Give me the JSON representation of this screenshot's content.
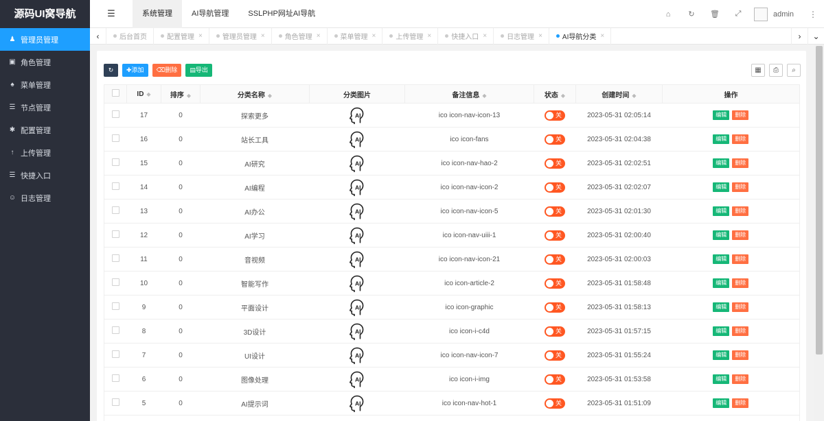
{
  "app": {
    "title": "源码UI窝导航"
  },
  "sidebar": {
    "items": [
      {
        "label": "管理员管理",
        "icon": "user-icon",
        "glyph": "♟",
        "active": true
      },
      {
        "label": "角色管理",
        "icon": "role-icon",
        "glyph": "▣"
      },
      {
        "label": "菜单管理",
        "icon": "bell-icon",
        "glyph": "♠"
      },
      {
        "label": "节点管理",
        "icon": "list-icon",
        "glyph": "☰"
      },
      {
        "label": "配置管理",
        "icon": "gear-icon",
        "glyph": "✱"
      },
      {
        "label": "上传管理",
        "icon": "upload-icon",
        "glyph": "↑"
      },
      {
        "label": "快捷入口",
        "icon": "list-icon",
        "glyph": "☰"
      },
      {
        "label": "日志管理",
        "icon": "log-icon",
        "glyph": "☺"
      }
    ]
  },
  "header": {
    "nav": [
      {
        "label": "系统管理",
        "active": true
      },
      {
        "label": "AI导航管理"
      },
      {
        "label": "SSLPHP网址AI导航"
      }
    ],
    "user": "admin"
  },
  "tabs": [
    {
      "label": "后台首页",
      "closable": false
    },
    {
      "label": "配置管理",
      "closable": true
    },
    {
      "label": "管理员管理",
      "closable": true
    },
    {
      "label": "角色管理",
      "closable": true
    },
    {
      "label": "菜单管理",
      "closable": true
    },
    {
      "label": "上传管理",
      "closable": true
    },
    {
      "label": "快捷入口",
      "closable": true
    },
    {
      "label": "日志管理",
      "closable": true
    },
    {
      "label": "AI导航分类",
      "closable": true,
      "active": true
    }
  ],
  "toolbar": {
    "add_label": "添加",
    "delete_label": "删除",
    "export_label": "导出"
  },
  "table": {
    "headers": {
      "id": "ID",
      "sort": "排序",
      "name": "分类名称",
      "image": "分类图片",
      "remark": "备注信息",
      "status": "状态",
      "created": "创建时间",
      "actions": "操作"
    },
    "status_off_label": "关",
    "edit_label": "编辑",
    "delete_label": "删除",
    "rows": [
      {
        "id": "17",
        "sort": "0",
        "name": "探索更多",
        "remark": "ico icon-nav-icon-13",
        "created": "2023-05-31 02:05:14"
      },
      {
        "id": "16",
        "sort": "0",
        "name": "站长工具",
        "remark": "ico icon-fans",
        "created": "2023-05-31 02:04:38"
      },
      {
        "id": "15",
        "sort": "0",
        "name": "AI研究",
        "remark": "ico icon-nav-hao-2",
        "created": "2023-05-31 02:02:51"
      },
      {
        "id": "14",
        "sort": "0",
        "name": "AI编程",
        "remark": "ico icon-nav-icon-2",
        "created": "2023-05-31 02:02:07"
      },
      {
        "id": "13",
        "sort": "0",
        "name": "AI办公",
        "remark": "ico icon-nav-icon-5",
        "created": "2023-05-31 02:01:30"
      },
      {
        "id": "12",
        "sort": "0",
        "name": "AI学习",
        "remark": "ico icon-nav-uiii-1",
        "created": "2023-05-31 02:00:40"
      },
      {
        "id": "11",
        "sort": "0",
        "name": "音视频",
        "remark": "ico icon-nav-icon-21",
        "created": "2023-05-31 02:00:03"
      },
      {
        "id": "10",
        "sort": "0",
        "name": "智能写作",
        "remark": "ico icon-article-2",
        "created": "2023-05-31 01:58:48"
      },
      {
        "id": "9",
        "sort": "0",
        "name": "平面设计",
        "remark": "ico icon-graphic",
        "created": "2023-05-31 01:58:13"
      },
      {
        "id": "8",
        "sort": "0",
        "name": "3D设计",
        "remark": "ico icon-i-c4d",
        "created": "2023-05-31 01:57:15"
      },
      {
        "id": "7",
        "sort": "0",
        "name": "UI设计",
        "remark": "ico icon-nav-icon-7",
        "created": "2023-05-31 01:55:24"
      },
      {
        "id": "6",
        "sort": "0",
        "name": "图像处理",
        "remark": "ico icon-i-img",
        "created": "2023-05-31 01:53:58"
      },
      {
        "id": "5",
        "sort": "0",
        "name": "AI提示词",
        "remark": "ico icon-nav-hot-1",
        "created": "2023-05-31 01:51:09"
      },
      {
        "id": "",
        "sort": "",
        "name": "",
        "remark": "",
        "created": ""
      }
    ]
  }
}
